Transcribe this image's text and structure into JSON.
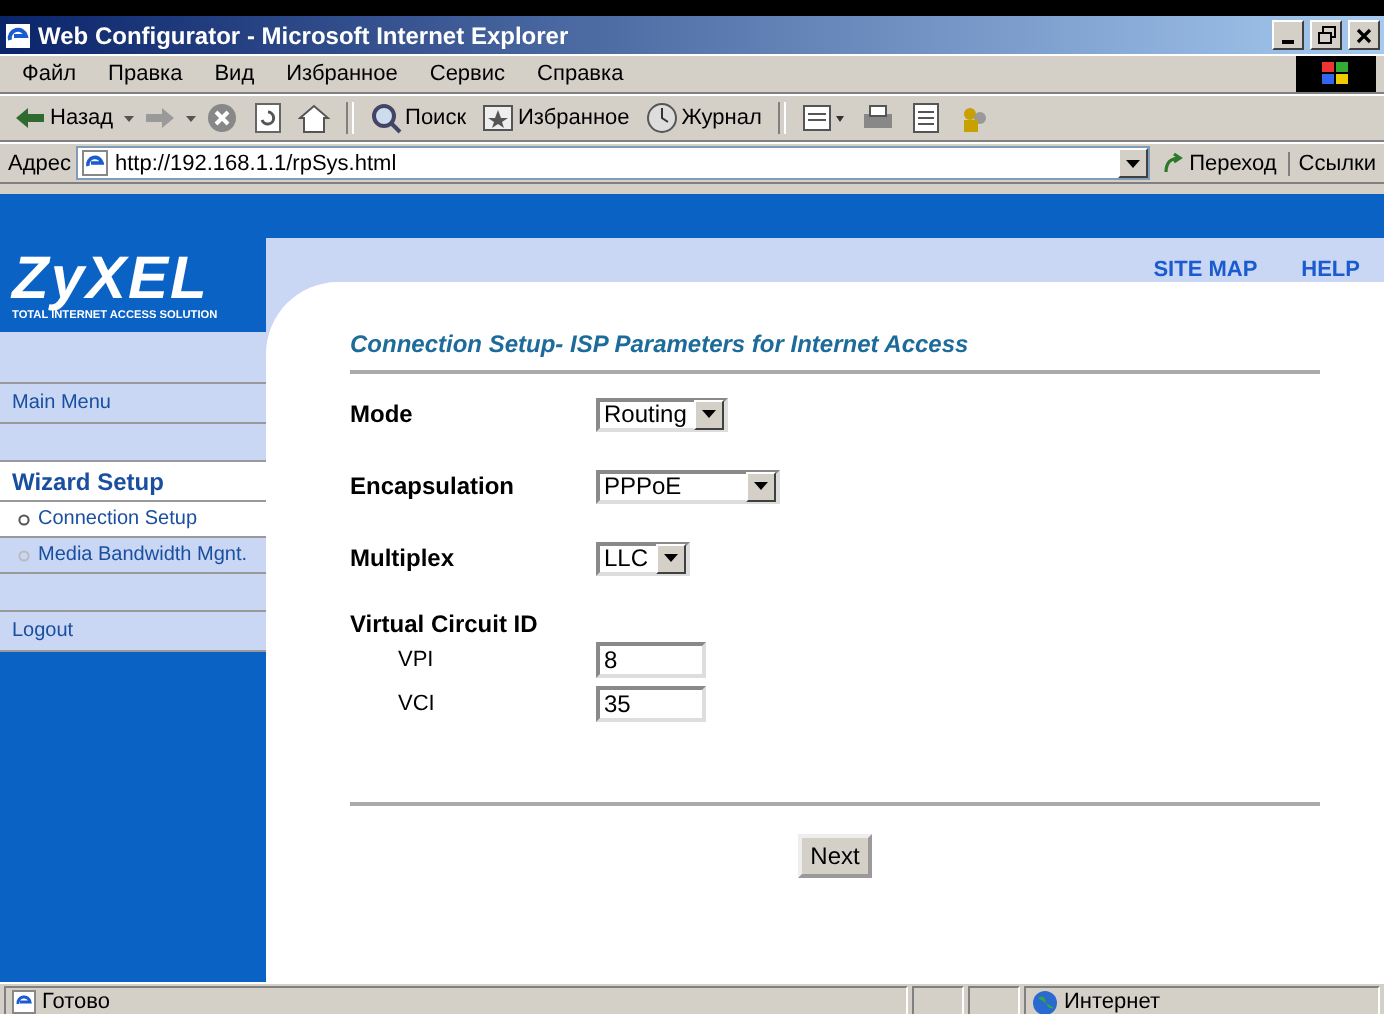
{
  "window": {
    "title": "Web Configurator - Microsoft Internet Explorer"
  },
  "menu": [
    "Файл",
    "Правка",
    "Вид",
    "Избранное",
    "Сервис",
    "Справка"
  ],
  "toolbar": [
    {
      "kind": "back",
      "label": "Назад"
    },
    {
      "kind": "forward"
    },
    {
      "kind": "stop"
    },
    {
      "kind": "refresh"
    },
    {
      "kind": "home"
    },
    {
      "kind": "search",
      "label": "Поиск"
    },
    {
      "kind": "favorites",
      "label": "Избранное"
    },
    {
      "kind": "history",
      "label": "Журнал"
    },
    {
      "kind": "mail"
    },
    {
      "kind": "print"
    },
    {
      "kind": "edit"
    },
    {
      "kind": "messenger"
    }
  ],
  "address": {
    "label": "Адрес",
    "url": "http://192.168.1.1/rpSys.html",
    "go": "Переход",
    "links": "Ссылки"
  },
  "logo": {
    "name": "ZyXEL",
    "tagline": "TOTAL INTERNET ACCESS SOLUTION"
  },
  "top_links": [
    "SITE MAP",
    "HELP"
  ],
  "sidebar": [
    {
      "kind": "link",
      "label": "Main Menu",
      "selected": false
    },
    {
      "kind": "section",
      "label": "Wizard Setup",
      "selected": true
    },
    {
      "kind": "sub",
      "label": "Connection Setup",
      "selected": true
    },
    {
      "kind": "sub",
      "label": "Media Bandwidth Mgnt.",
      "selected": false
    },
    {
      "kind": "link",
      "label": "Logout",
      "selected": false
    }
  ],
  "form": {
    "title": "Connection Setup- ISP Parameters for Internet Access",
    "fields": [
      {
        "kind": "select",
        "label": "Mode",
        "value": "Routing"
      },
      {
        "kind": "select",
        "label": "Encapsulation",
        "value": "PPPoE"
      },
      {
        "kind": "select",
        "label": "Multiplex",
        "value": "LLC"
      },
      {
        "kind": "heading",
        "label": "Virtual Circuit ID"
      },
      {
        "kind": "text",
        "label": "VPI",
        "value": "8"
      },
      {
        "kind": "text",
        "label": "VCI",
        "value": "35"
      }
    ],
    "button": "Next"
  },
  "status_bar": {
    "text": "Готово",
    "zone": "Интернет"
  }
}
